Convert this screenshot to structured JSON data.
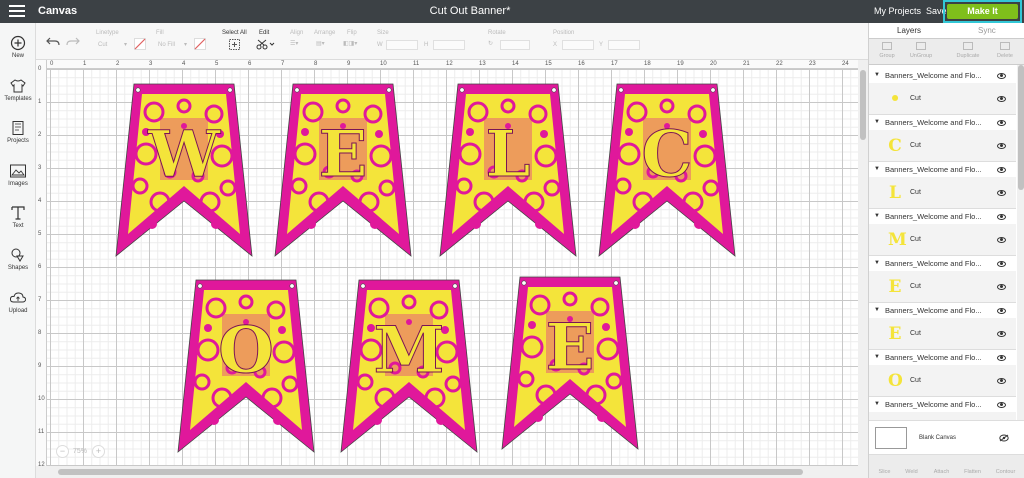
{
  "topbar": {
    "app_title": "Canvas",
    "doc_title": "Cut Out Banner*",
    "my_projects": "My Projects",
    "save": "Save",
    "make_it": "Make It"
  },
  "sidebar": {
    "items": [
      {
        "label": "New",
        "icon": "plus-circle-icon"
      },
      {
        "label": "Templates",
        "icon": "shirt-icon"
      },
      {
        "label": "Projects",
        "icon": "book-icon"
      },
      {
        "label": "Images",
        "icon": "image-icon"
      },
      {
        "label": "Text",
        "icon": "text-t-icon"
      },
      {
        "label": "Shapes",
        "icon": "shapes-icon"
      },
      {
        "label": "Upload",
        "icon": "cloud-upload-icon"
      }
    ]
  },
  "toolbar": {
    "linetype_label": "Linetype",
    "linetype_value": "Cut",
    "fill_label": "Fill",
    "fill_value": "No Fill",
    "select_all": "Select All",
    "edit": "Edit",
    "align": "Align",
    "arrange": "Arrange",
    "flip": "Flip",
    "size": "Size",
    "size_w": "W",
    "size_h": "H",
    "rotate": "Rotate",
    "position": "Position",
    "pos_x": "X",
    "pos_y": "Y"
  },
  "ruler": {
    "top": [
      "0",
      "1",
      "2",
      "3",
      "4",
      "5",
      "6",
      "7",
      "8",
      "9",
      "10",
      "11",
      "12",
      "13",
      "14",
      "15",
      "16",
      "17",
      "18",
      "19",
      "20",
      "21",
      "22",
      "23",
      "24"
    ],
    "left": [
      "0",
      "1",
      "2",
      "3",
      "4",
      "5",
      "6",
      "7",
      "8",
      "9",
      "10",
      "11",
      "12"
    ]
  },
  "zoom": {
    "value": "75%",
    "minus": "−",
    "plus": "+"
  },
  "banners": [
    {
      "letter": "W"
    },
    {
      "letter": "E"
    },
    {
      "letter": "L"
    },
    {
      "letter": "C"
    },
    {
      "letter": "O"
    },
    {
      "letter": "M"
    },
    {
      "letter": "E"
    }
  ],
  "colors": {
    "banner": "#e0189b",
    "letter": "#f4e43a",
    "accent": "#7fbf1b"
  },
  "panel": {
    "tabs": {
      "layers": "Layers",
      "sync": "Sync"
    },
    "actions": [
      "Group",
      "UnGroup",
      "Duplicate",
      "Delete"
    ],
    "group_name": "Banners_Welcome and Flo...",
    "layers": [
      {
        "letter": "•",
        "label": "Cut"
      },
      {
        "letter": "C",
        "label": "Cut"
      },
      {
        "letter": "L",
        "label": "Cut"
      },
      {
        "letter": "M",
        "label": "Cut"
      },
      {
        "letter": "E",
        "label": "Cut"
      },
      {
        "letter": "E",
        "label": "Cut"
      },
      {
        "letter": "O",
        "label": "Cut"
      },
      {
        "letter": "",
        "label": "Cut"
      }
    ],
    "blank_canvas": "Blank Canvas",
    "bottom_actions": [
      "Slice",
      "Weld",
      "Attach",
      "Flatten",
      "Contour"
    ]
  }
}
